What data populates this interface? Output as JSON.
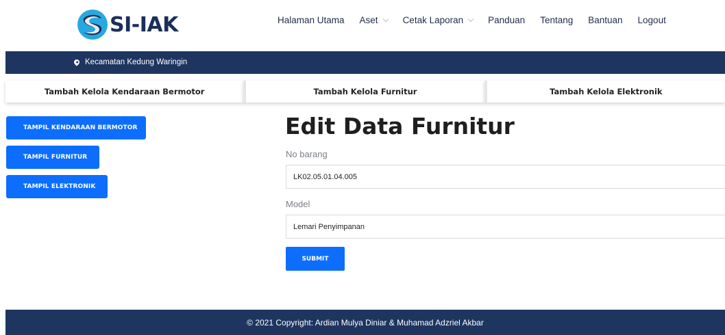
{
  "brand": {
    "name": "SI-IAK",
    "logo_icon": "swoosh-s-logo"
  },
  "nav": {
    "items": [
      {
        "label": "Halaman Utama",
        "dropdown": false
      },
      {
        "label": "Aset",
        "dropdown": true
      },
      {
        "label": "Cetak Laporan",
        "dropdown": true
      },
      {
        "label": "Panduan",
        "dropdown": false
      },
      {
        "label": "Tentang",
        "dropdown": false
      },
      {
        "label": "Bantuan",
        "dropdown": false
      },
      {
        "label": "Logout",
        "dropdown": false
      }
    ]
  },
  "location": {
    "icon": "map-pin-icon",
    "text": "Kecamatan Kedung Waringin"
  },
  "tabs": [
    {
      "label": "Tambah Kelola Kendaraan Bermotor"
    },
    {
      "label": "Tambah Kelola Furnitur"
    },
    {
      "label": "Tambah Kelola Elektronik"
    }
  ],
  "sidebar": {
    "buttons": [
      {
        "label": "TAMPIL KENDARAAN BERMOTOR"
      },
      {
        "label": "TAMPIL FURNITUR"
      },
      {
        "label": "TAMPIL ELEKTRONIK"
      }
    ]
  },
  "form": {
    "title": "Edit Data Furnitur",
    "no_barang": {
      "label": "No barang",
      "value": "LK02.05.01.04.005"
    },
    "model": {
      "label": "Model",
      "value": "Lemari Penyimpanan"
    },
    "submit_label": "SUBMIT"
  },
  "footer": {
    "text": "© 2021 Copyright: Ardian Mulya Diniar & Muhamad Adzriel Akbar"
  },
  "colors": {
    "primary": "#0d6efd",
    "navy": "#1e3560",
    "brand_dark": "#1b2f59",
    "brand_light": "#29a8e0"
  }
}
